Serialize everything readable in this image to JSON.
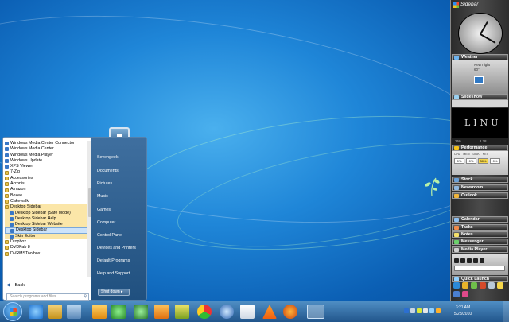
{
  "start_menu": {
    "programs": [
      {
        "label": "Windows Media Center Connector",
        "type": "app",
        "icon": "media-center-icon"
      },
      {
        "label": "Windows Media Center",
        "type": "app",
        "icon": "media-center-icon"
      },
      {
        "label": "Windows Media Player",
        "type": "app",
        "icon": "media-player-icon"
      },
      {
        "label": "Windows Update",
        "type": "app",
        "icon": "update-icon"
      },
      {
        "label": "XPS Viewer",
        "type": "app",
        "icon": "xps-icon"
      },
      {
        "label": "7-Zip",
        "type": "folder",
        "icon": "folder-icon"
      },
      {
        "label": "Accessories",
        "type": "folder",
        "icon": "folder-icon"
      },
      {
        "label": "Acronis",
        "type": "folder",
        "icon": "folder-icon"
      },
      {
        "label": "Amazon",
        "type": "folder",
        "icon": "folder-icon"
      },
      {
        "label": "Boxee",
        "type": "folder",
        "icon": "folder-icon"
      },
      {
        "label": "Cakewalk",
        "type": "folder",
        "icon": "folder-icon"
      },
      {
        "label": "Desktop Sidebar",
        "type": "folder",
        "icon": "folder-icon",
        "state": "highlight"
      },
      {
        "label": "Desktop Sidebar (Safe Mode)",
        "type": "app",
        "sub": true,
        "icon": "sidebar-icon",
        "state": "highlight"
      },
      {
        "label": "Desktop Sidebar Help",
        "type": "app",
        "sub": true,
        "icon": "help-icon",
        "state": "highlight"
      },
      {
        "label": "Desktop Sidebar Website",
        "type": "app",
        "sub": true,
        "icon": "web-icon",
        "state": "highlight"
      },
      {
        "label": "Desktop Sidebar",
        "type": "app",
        "sub": true,
        "icon": "sidebar-icon",
        "state": "selected"
      },
      {
        "label": "Skin Editor",
        "type": "app",
        "sub": true,
        "icon": "skin-icon",
        "state": "highlight"
      },
      {
        "label": "Dropbox",
        "type": "folder",
        "icon": "folder-icon"
      },
      {
        "label": "DVDFab 8",
        "type": "folder",
        "icon": "folder-icon"
      },
      {
        "label": "DVRMSToolbox",
        "type": "folder",
        "icon": "folder-icon"
      }
    ],
    "back_label": "Back",
    "search_placeholder": "Search programs and files",
    "right_items": [
      "Sevengeek",
      "Documents",
      "Pictures",
      "Music",
      "Games",
      "Computer",
      "Control Panel",
      "Devices and Printers",
      "Default Programs",
      "Help and Support"
    ],
    "shutdown_label": "Shut down"
  },
  "taskbar": {
    "time": "3:21 AM",
    "date": "5/28/2010"
  },
  "sidebar": {
    "title": "Sidebar",
    "weather": {
      "title": "Weather",
      "line1": "New night",
      "line2": "60°"
    },
    "slideshow": {
      "title": "Slideshow",
      "image_text": "LINU",
      "footer_left": "250",
      "footer_right": "8.28"
    },
    "performance": {
      "title": "Performance",
      "labels": [
        "CPU",
        "MEM",
        "DISK",
        "NET"
      ],
      "values": [
        "0%",
        "0%",
        "30%",
        "0%"
      ]
    },
    "panels": [
      "Stock",
      "Newsroom",
      "Outlook",
      "Calendar",
      "Tasks",
      "Notes",
      "Messenger",
      "Media Player"
    ],
    "quick_launch_title": "Quick Launch"
  },
  "colors": {
    "accent": "#1f86d8",
    "highlight": "#fbe6a8",
    "selected": "#cde3fa"
  }
}
